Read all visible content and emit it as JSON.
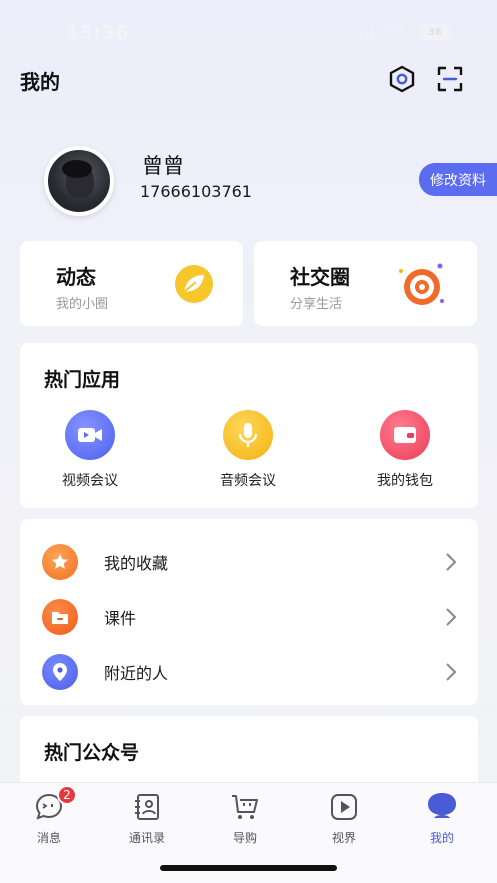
{
  "status": {
    "time": "15:36",
    "battery": "38"
  },
  "header": {
    "title": "我的"
  },
  "profile": {
    "name": "曾曾",
    "phone": "17666103761",
    "edit_label": "修改资料"
  },
  "features": [
    {
      "title": "动态",
      "subtitle": "我的小圈"
    },
    {
      "title": "社交圈",
      "subtitle": "分享生活"
    }
  ],
  "hot_apps": {
    "title": "热门应用",
    "items": [
      {
        "label": "视频会议",
        "icon": "video-camera-icon",
        "color": "#5a6df3"
      },
      {
        "label": "音频会议",
        "icon": "microphone-icon",
        "color": "#f5b614"
      },
      {
        "label": "我的钱包",
        "icon": "wallet-icon",
        "color": "#f04a63"
      }
    ]
  },
  "menu": [
    {
      "label": "我的收藏",
      "icon": "star-icon",
      "color": "#f37d24"
    },
    {
      "label": "课件",
      "icon": "folder-icon",
      "color": "#f36d24"
    },
    {
      "label": "附近的人",
      "icon": "location-pin-icon",
      "color": "#4f63e8"
    }
  ],
  "public_accounts": {
    "title": "热门公众号"
  },
  "tabbar": {
    "items": [
      {
        "label": "消息",
        "icon": "chat-bubble-icon",
        "badge": "2"
      },
      {
        "label": "通讯录",
        "icon": "contacts-book-icon"
      },
      {
        "label": "导购",
        "icon": "shopping-cart-icon"
      },
      {
        "label": "视界",
        "icon": "play-video-icon"
      },
      {
        "label": "我的",
        "icon": "profile-icon"
      }
    ],
    "active_color": "#4a5bd6"
  }
}
